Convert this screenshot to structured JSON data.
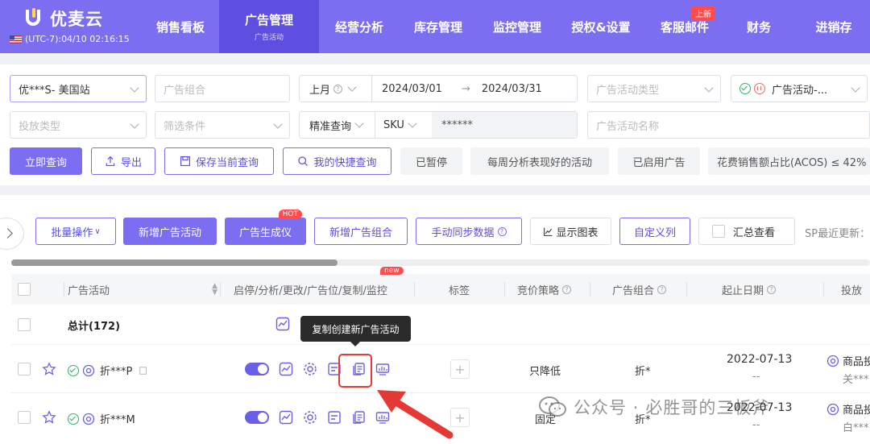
{
  "nav": {
    "logo": "优麦云",
    "timezone": "(UTC-7):04/10 02:16:15",
    "items": [
      {
        "label": "销售看板"
      },
      {
        "label": "广告管理",
        "sub": "广告活动"
      },
      {
        "label": "经营分析"
      },
      {
        "label": "库存管理"
      },
      {
        "label": "监控管理"
      },
      {
        "label": "授权&设置"
      },
      {
        "label": "客服邮件",
        "badge": "上新"
      },
      {
        "label": "财务"
      },
      {
        "label": "进销存"
      }
    ]
  },
  "filters": {
    "store": "优***S- 美国站",
    "ad_group_placeholder": "广告组合",
    "period": "上月",
    "date_start": "2024/03/01",
    "date_end": "2024/03/31",
    "date_arrow": "→",
    "campaign_type_placeholder": "广告活动类型",
    "status_select": "广告活动-...",
    "delivery_type_placeholder": "投放类型",
    "filter_cond_placeholder": "筛选条件",
    "match_mode": "精准查询",
    "sku_label": "SKU",
    "sku_value": "******",
    "campaign_name_placeholder": "广告活动名称"
  },
  "actions": {
    "query": "立即查询",
    "export": "导出",
    "save_query": "保存当前查询",
    "my_quick_query": "我的快捷查询",
    "quick_tags": [
      "已暂停",
      "每周分析表现好的活动",
      "已启用广告",
      "花费销售额占比(ACOS) ≤ 42%"
    ]
  },
  "toolbar": {
    "batch": "批量操作",
    "new_campaign": "新增广告活动",
    "generator": "广告生成仪",
    "hot": "HOT",
    "new_group": "新增广告组合",
    "sync": "手动同步数据",
    "show_chart": "显示图表",
    "custom_cols": "自定义列",
    "summary": "汇总查看",
    "sp_update": "SP最近更新："
  },
  "table": {
    "headers": {
      "campaign": "广告活动",
      "ops": "启停/分析/更改/广告位/复制/监控",
      "ops_badge": "new",
      "tag": "标签",
      "bid_strategy": "竞价策略",
      "ad_group": "广告组合",
      "date_range": "起止日期",
      "delivery": "投放"
    },
    "total_label": "总计(172)",
    "rows": [
      {
        "name": "折***P",
        "bid": "只降低",
        "group": "折*",
        "date": "2022-07-13",
        "date_end": "--",
        "delivery": "商品投",
        "delivery_sub": "关***"
      },
      {
        "name": "折***M",
        "bid": "固定",
        "group": "折*",
        "date": "2022-07-13",
        "date_end": "--",
        "delivery": "商品投",
        "delivery_sub": "白***"
      }
    ]
  },
  "tooltip": "复制创建新广告活动",
  "watermark": {
    "prefix": "公众号 · ",
    "name": "必胜哥的三板斧"
  },
  "colors": {
    "primary": "#7b6ef0",
    "nav_active": "#5d4fe0",
    "badge": "#ff4d4f",
    "highlight": "#e53935"
  }
}
